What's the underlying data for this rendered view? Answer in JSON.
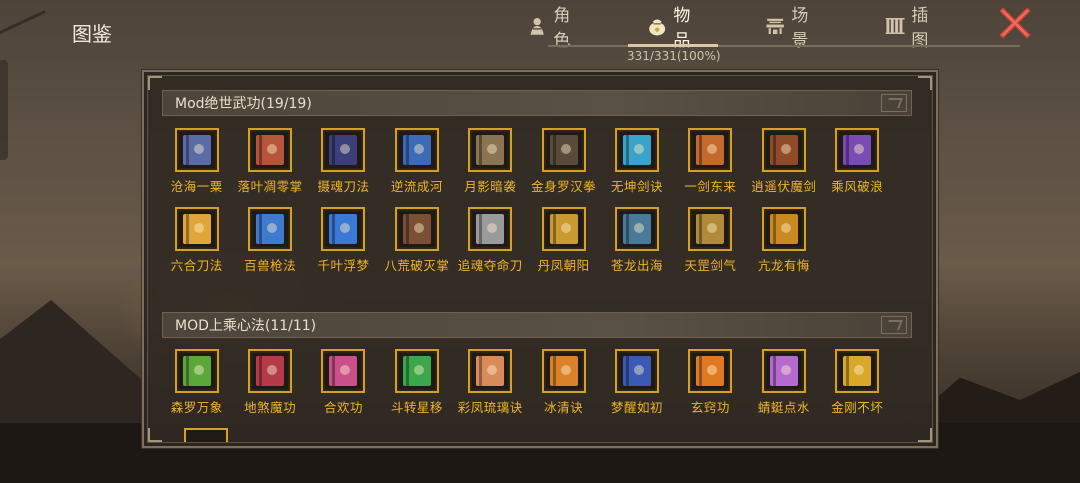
{
  "header": {
    "title": "图鉴",
    "tabs": [
      {
        "label": "角色",
        "icon": "character-icon"
      },
      {
        "label": "物品",
        "icon": "item-bag-icon"
      },
      {
        "label": "场景",
        "icon": "scene-icon"
      },
      {
        "label": "插图",
        "icon": "illustration-icon"
      }
    ],
    "active_tab": "物品",
    "progress": "331/331(100%)"
  },
  "colors": {
    "accent": "#d6a021",
    "label": "#f0b429",
    "close": "#d9453a"
  },
  "sections": [
    {
      "title": "Mod绝世武功(19/19)",
      "items": [
        {
          "label": "沧海一粟",
          "color": "#5a6ca6"
        },
        {
          "label": "落叶凋零掌",
          "color": "#b5553a"
        },
        {
          "label": "摄魂刀法",
          "color": "#3b3f7a"
        },
        {
          "label": "逆流成河",
          "color": "#3b6ab8"
        },
        {
          "label": "月影暗袭",
          "color": "#8a7452"
        },
        {
          "label": "金身罗汉拳",
          "color": "#5a4a3a"
        },
        {
          "label": "无坤剑诀",
          "color": "#3aa3c9"
        },
        {
          "label": "一剑东来",
          "color": "#c46a2e"
        },
        {
          "label": "逍遥伏魔剑",
          "color": "#8f4a2a"
        },
        {
          "label": "乘风破浪",
          "color": "#7a4bb5"
        },
        {
          "label": "六合刀法",
          "color": "#e0a63a"
        },
        {
          "label": "百兽枪法",
          "color": "#3d7ad0"
        },
        {
          "label": "千叶浮梦",
          "color": "#3a7ad6"
        },
        {
          "label": "八荒破灭掌",
          "color": "#7a4f34"
        },
        {
          "label": "追魂夺命刀",
          "color": "#9a9a9a"
        },
        {
          "label": "丹凤朝阳",
          "color": "#c99a32"
        },
        {
          "label": "苍龙出海",
          "color": "#4a7a9a"
        },
        {
          "label": "天罡剑气",
          "color": "#b08a3a"
        },
        {
          "label": "亢龙有悔",
          "color": "#c98a22"
        }
      ]
    },
    {
      "title": "MOD上乘心法(11/11)",
      "items": [
        {
          "label": "森罗万象",
          "color": "#5aa83a"
        },
        {
          "label": "地煞魔功",
          "color": "#b53a4a"
        },
        {
          "label": "合欢功",
          "color": "#c9508a"
        },
        {
          "label": "斗转星移",
          "color": "#3aa84a"
        },
        {
          "label": "彩凤琉璃诀",
          "color": "#d98a5a"
        },
        {
          "label": "冰清诀",
          "color": "#d9822a"
        },
        {
          "label": "梦醒如初",
          "color": "#3a5ab5"
        },
        {
          "label": "玄窍功",
          "color": "#e07a22"
        },
        {
          "label": "蜻蜓点水",
          "color": "#b56ad0"
        },
        {
          "label": "金刚不坏",
          "color": "#d9a82a"
        }
      ]
    }
  ]
}
